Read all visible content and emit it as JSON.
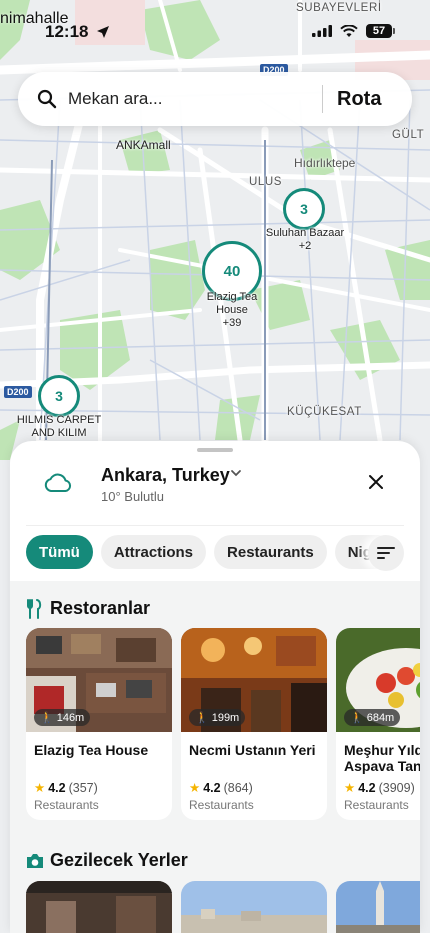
{
  "status_bar": {
    "carrier": "nimahalle",
    "time": "12:18",
    "battery": "57"
  },
  "map": {
    "labels": {
      "subayevleri": "SUBAYEVLERİ",
      "ulus": "ULUS",
      "hidirliktepe": "Hıdırlıktepe",
      "gult": "GÜLT",
      "kucukesat": "KÜÇÜKESAT",
      "ankamall": "ANKAmall",
      "road_d200_top": "D200",
      "road_d200_left": "D200"
    },
    "clusters": [
      {
        "count": "3",
        "name": "Suluhan Bazaar",
        "more": "+2"
      },
      {
        "count": "40",
        "name": "Elazig Tea House",
        "more": "+39"
      },
      {
        "count": "3",
        "name": "HILMIS CARPET AND KILIM",
        "more": ""
      }
    ]
  },
  "search": {
    "placeholder": "Mekan ara...",
    "route_label": "Rota"
  },
  "sheet": {
    "location": "Ankara, Turkey",
    "weather": "10° Bulutlu",
    "chips": [
      "Tümü",
      "Attractions",
      "Restaurants",
      "Nigh"
    ],
    "restaurants_title": "Restoranlar",
    "restaurants": [
      {
        "name": "Elazig Tea House",
        "distance": "146m",
        "rating": "4.2",
        "count": "(357)",
        "category": "Restaurants"
      },
      {
        "name": "Necmi Ustanın Yeri",
        "distance": "199m",
        "rating": "4.2",
        "count": "(864)",
        "category": "Restaurants"
      },
      {
        "name": "Meşhur Yıldız Aspava Tandır",
        "distance": "684m",
        "rating": "4.2",
        "count": "(3909)",
        "category": "Restaurants"
      }
    ],
    "sights_title": "Gezilecek Yerler"
  },
  "colors": {
    "accent": "#158a7a",
    "star": "#f5b400",
    "park": "#bfe4b5"
  }
}
